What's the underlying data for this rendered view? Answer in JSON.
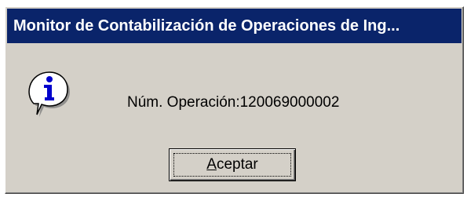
{
  "window": {
    "title": "Monitor de Contabilización de Operaciones de Ing..."
  },
  "message": {
    "text": "Núm. Operación:120069000002"
  },
  "icon": "information-icon",
  "buttons": {
    "ok_label": "Aceptar",
    "ok_mnemonic": "A",
    "ok_rest": "ceptar"
  },
  "colors": {
    "title_bar": "#0a246a",
    "dialog_bg": "#d4d0c8",
    "icon_blue": "#0000cc"
  }
}
